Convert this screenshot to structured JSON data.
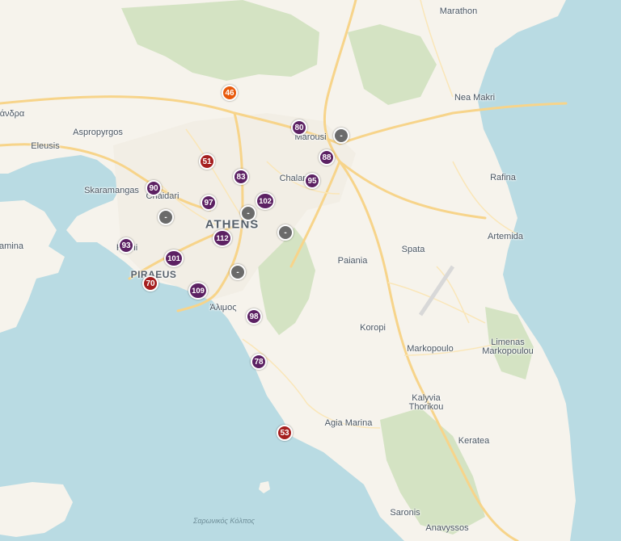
{
  "colors": {
    "sea": "#b9dbe3",
    "land": "#f6f3ec",
    "forest": "#d4e3c3",
    "major_road": "#f7d48a",
    "minor_road": "#fae6b8",
    "aqi_orange": "#e8590c",
    "aqi_red": "#a51f1f",
    "aqi_purple": "#5c2163",
    "aqi_nodata": "#6b6b6b"
  },
  "places": {
    "marathon": "Marathon",
    "nea_makri": "Nea Makri",
    "andra": "άνδρα",
    "aspropyrgos": "Aspropyrgos",
    "eleusis": "Eleusis",
    "marousi": "Marousi",
    "rafina": "Rafina",
    "skaramangas": "Skaramangas",
    "chaidari": "Chaidari",
    "chalandri": "Chalan",
    "athens": "ATHENS",
    "artemida": "Artemida",
    "salamina": "amina",
    "korydallos": "K      llini",
    "spata": "Spata",
    "paiania": "Paiania",
    "piraeus": "PIRAEUS",
    "alimos": "Άλιμος",
    "koropi": "Koropi",
    "markopoulo": "Markopoulo",
    "limenas_line1": "Limenas",
    "limenas_line2": "Markopoulou",
    "kalyvia_line1": "Kalyvia",
    "kalyvia_line2": "Thorikou",
    "agia_marina": "Agia Marina",
    "keratea": "Keratea",
    "saronis": "Saronis",
    "anavyssos": "Anavyssos",
    "saronic_gulf": "Σαρωνικός Κόλπος"
  },
  "stations": [
    {
      "value": "46",
      "level": "orange"
    },
    {
      "value": "80",
      "level": "purple"
    },
    {
      "value": "-",
      "level": "nodata"
    },
    {
      "value": "88",
      "level": "purple"
    },
    {
      "value": "51",
      "level": "red"
    },
    {
      "value": "83",
      "level": "purple"
    },
    {
      "value": "95",
      "level": "purple"
    },
    {
      "value": "90",
      "level": "purple"
    },
    {
      "value": "97",
      "level": "purple"
    },
    {
      "value": "102",
      "level": "purple"
    },
    {
      "value": "-",
      "level": "nodata"
    },
    {
      "value": "-",
      "level": "nodata"
    },
    {
      "value": "-",
      "level": "nodata"
    },
    {
      "value": "112",
      "level": "purple"
    },
    {
      "value": "93",
      "level": "purple"
    },
    {
      "value": "101",
      "level": "purple"
    },
    {
      "value": "-",
      "level": "nodata"
    },
    {
      "value": "70",
      "level": "red"
    },
    {
      "value": "109",
      "level": "purple"
    },
    {
      "value": "98",
      "level": "purple"
    },
    {
      "value": "78",
      "level": "purple"
    },
    {
      "value": "53",
      "level": "red"
    }
  ]
}
